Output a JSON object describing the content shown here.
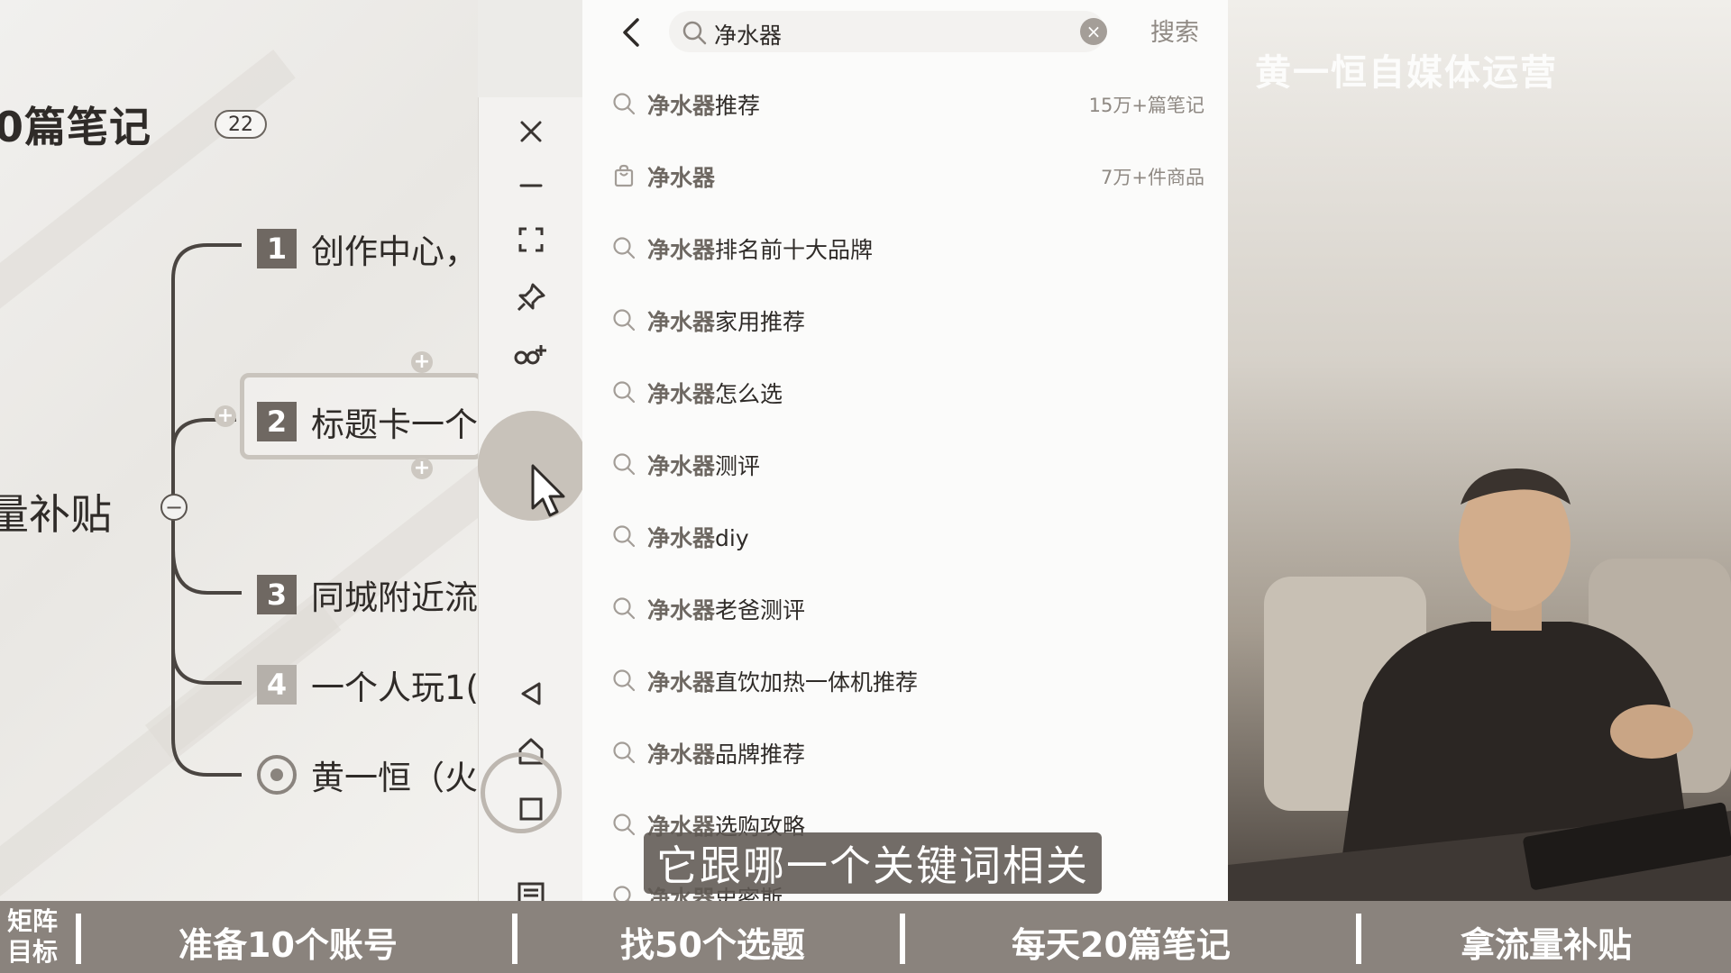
{
  "mindmap": {
    "title": "0篇笔记",
    "badge": "22",
    "root": "量补贴",
    "nodes": [
      {
        "num": "1",
        "text": "创作中心，"
      },
      {
        "num": "2",
        "text": "标题卡一个"
      },
      {
        "num": "3",
        "text": "同城附近流"
      },
      {
        "num": "4",
        "text": "一个人玩1("
      },
      {
        "num": "",
        "text": "黄一恒（火"
      }
    ]
  },
  "toolbar": {
    "icons": [
      "close-icon",
      "minimize-icon",
      "fullscreen-icon",
      "pin-icon",
      "link-add-icon",
      "back-triangle-icon",
      "home-icon",
      "square-icon",
      "keyboard-icon"
    ]
  },
  "search": {
    "query": "净水器",
    "clear": "×",
    "submit": "搜索",
    "suggestions": [
      {
        "highlight": "净水器",
        "rest": "推荐",
        "meta": "15万+篇笔记",
        "icon": "search-icon"
      },
      {
        "highlight": "净水器",
        "rest": "",
        "meta": "7万+件商品",
        "icon": "shopping-bag-icon"
      },
      {
        "highlight": "净水器",
        "rest": "排名前十大品牌",
        "meta": "",
        "icon": "search-icon"
      },
      {
        "highlight": "净水器",
        "rest": "家用推荐",
        "meta": "",
        "icon": "search-icon"
      },
      {
        "highlight": "净水器",
        "rest": "怎么选",
        "meta": "",
        "icon": "search-icon"
      },
      {
        "highlight": "净水器",
        "rest": "测评",
        "meta": "",
        "icon": "search-icon"
      },
      {
        "highlight": "净水器",
        "rest": "diy",
        "meta": "",
        "icon": "search-icon"
      },
      {
        "highlight": "净水器",
        "rest": "老爸测评",
        "meta": "",
        "icon": "search-icon"
      },
      {
        "highlight": "净水器",
        "rest": "直饮加热一体机推荐",
        "meta": "",
        "icon": "search-icon"
      },
      {
        "highlight": "净水器",
        "rest": "品牌推荐",
        "meta": "",
        "icon": "search-icon"
      },
      {
        "highlight": "净水器",
        "rest": "选购攻略",
        "meta": "",
        "icon": "search-icon"
      },
      {
        "highlight": "净水器",
        "rest": "史密斯",
        "meta": "",
        "icon": "search-icon"
      }
    ]
  },
  "video": {
    "watermark": "黄一恒自媒体运营"
  },
  "subtitle": "它跟哪一个关键词相关",
  "banner": {
    "label": "矩阵目标",
    "items": [
      "准备10个账号",
      "找50个选题",
      "每天20篇笔记",
      "拿流量补贴"
    ]
  }
}
